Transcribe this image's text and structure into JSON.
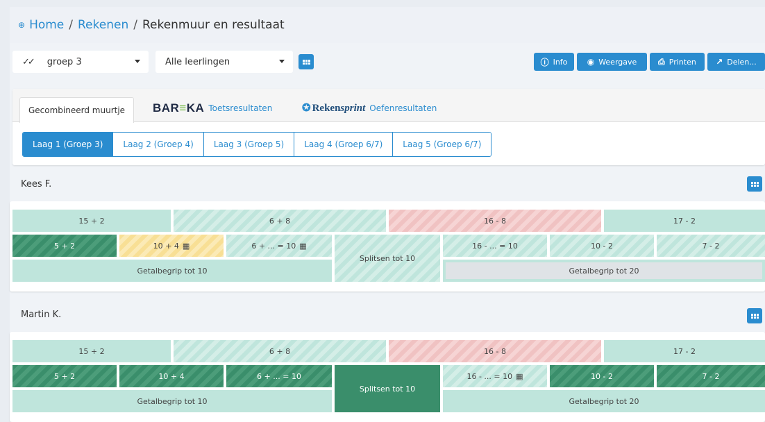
{
  "breadcrumb": {
    "home": "Home",
    "sep1": "/",
    "section": "Rekenen",
    "sep2": "/",
    "current": "Rekenmuur en resultaat"
  },
  "toolbar": {
    "group_select": "groep 3",
    "students_select": "Alle leerlingen",
    "info": "Info",
    "view": "Weergave",
    "print": "Printen",
    "share": "Delen..."
  },
  "tabs": {
    "combined": "Gecombineerd muurtje",
    "bareka_logo_a": "BAR",
    "bareka_logo_b": "≡",
    "bareka_logo_c": "KA",
    "bareka_link": "Toetsresultaten",
    "rekensprint_logo_a": "Reken",
    "rekensprint_logo_b": "sprint",
    "rekensprint_link": "Oefenresultaten"
  },
  "layers": [
    "Laag 1 (Groep 3)",
    "Laag 2 (Groep 4)",
    "Laag 3 (Groep 5)",
    "Laag 4 (Groep 6/7)",
    "Laag 5 (Groep 6/7)"
  ],
  "students": [
    {
      "name": "Kees F.",
      "row1": [
        "15 + 2",
        "6 + 8",
        "16 - 8",
        "17 - 2"
      ],
      "row2": [
        "5 + 2",
        "10 + 4",
        "6 + ... = 10",
        "Splitsen tot 10",
        "16 - ... = 10",
        "10 - 2",
        "7 - 2"
      ],
      "row3": [
        "Getalbegrip tot 10",
        "Getalbegrip tot 20"
      ]
    },
    {
      "name": "Martin K.",
      "row1": [
        "15 + 2",
        "6 + 8",
        "16 - 8",
        "17 - 2"
      ],
      "row2": [
        "5 + 2",
        "10 + 4",
        "6 + ... = 10",
        "Splitsen tot 10",
        "16 - ... = 10",
        "10 - 2",
        "7 - 2"
      ],
      "row3": [
        "Getalbegrip tot 10",
        "Getalbegrip tot 20"
      ]
    }
  ],
  "icons": {
    "calendar": "📅"
  },
  "colors": {
    "accent": "#2a8ccf",
    "mastered": "#3a8e6b",
    "practiced": "#bfe5dc",
    "failed": "#f0c2c2",
    "in_progress": "#f8df95",
    "not_done": "#dfe3e6"
  }
}
